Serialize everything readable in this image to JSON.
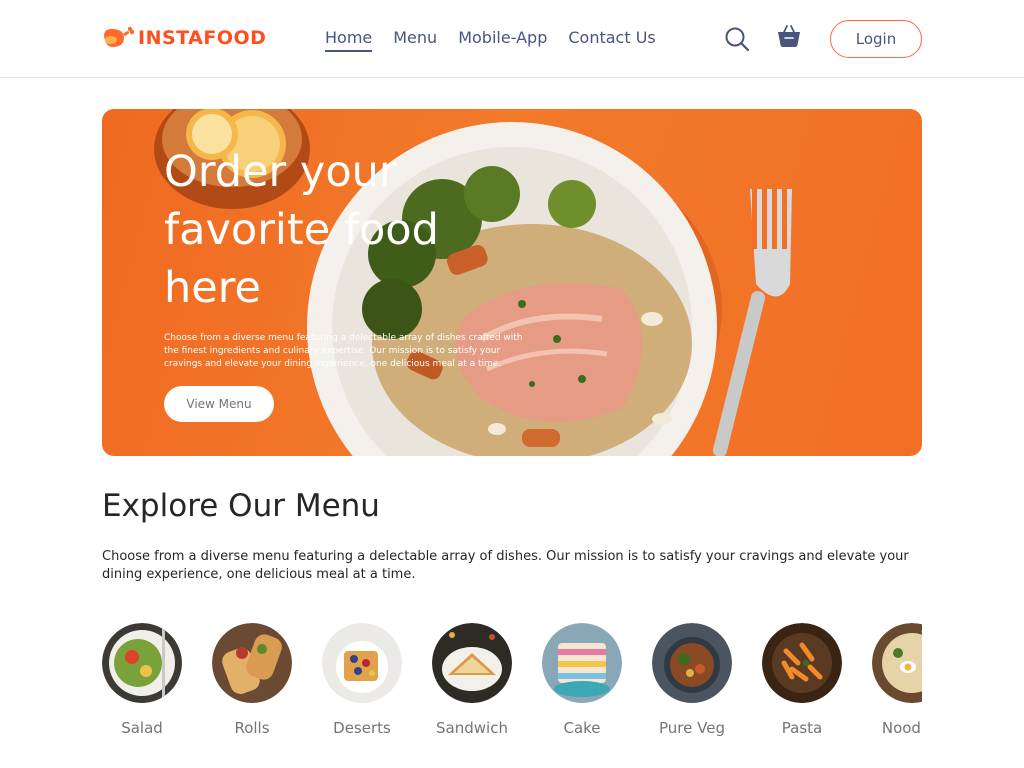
{
  "brand": {
    "name": "INSTAFOOD"
  },
  "nav": {
    "items": [
      {
        "label": "Home",
        "active": true
      },
      {
        "label": "Menu",
        "active": false
      },
      {
        "label": "Mobile-App",
        "active": false
      },
      {
        "label": "Contact Us",
        "active": false
      }
    ],
    "icons": [
      "search-icon",
      "basket-icon"
    ],
    "login_label": "Login"
  },
  "hero": {
    "title": "Order your favorite food here",
    "description": "Choose from a diverse menu featuring a delectable array of dishes crafted with the finest ingredients and culinary expertise. Our mission is to satisfy your cravings and elevate your dining experience, one delicious meal at a time.",
    "button_label": "View Menu"
  },
  "explore": {
    "title": "Explore Our Menu",
    "description": "Choose from a diverse menu featuring a delectable array of dishes. Our mission is to satisfy your cravings and elevate your dining experience, one delicious meal at a time.",
    "items": [
      {
        "label": "Salad"
      },
      {
        "label": "Rolls"
      },
      {
        "label": "Deserts"
      },
      {
        "label": "Sandwich"
      },
      {
        "label": "Cake"
      },
      {
        "label": "Pure Veg"
      },
      {
        "label": "Pasta"
      },
      {
        "label": "Noodles"
      }
    ]
  },
  "colors": {
    "brand": "#ff4f1f",
    "nav_text": "#49557e",
    "hero_bg": "#f06a22",
    "muted_text": "#747474"
  }
}
